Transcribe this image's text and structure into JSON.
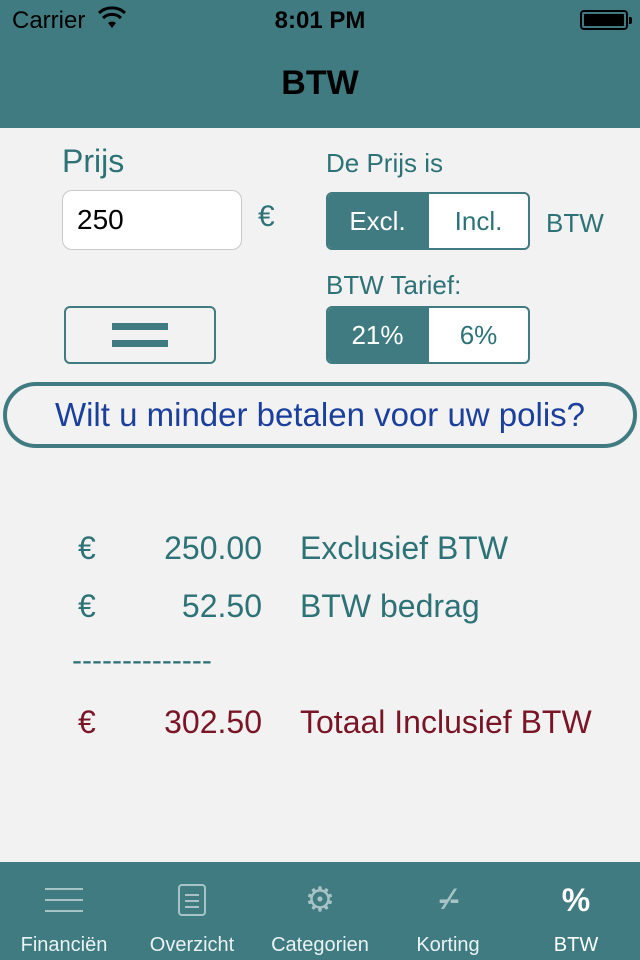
{
  "status_bar": {
    "carrier": "Carrier",
    "time": "8:01 PM"
  },
  "nav": {
    "title": "BTW"
  },
  "form": {
    "price_label": "Prijs",
    "price_value": "250",
    "currency_symbol": "€",
    "price_is_label": "De Prijs is",
    "incl_options": [
      "Excl.",
      "Incl."
    ],
    "incl_selected": "Excl.",
    "btw_suffix": "BTW",
    "rate_label": "BTW Tarief:",
    "rate_options": [
      "21%",
      "6%"
    ],
    "rate_selected": "21%",
    "menu_button_icon": "equals-icon"
  },
  "promo": {
    "text": "Wilt u minder betalen voor uw polis?"
  },
  "results": {
    "excl": {
      "currency": "€",
      "amount": "250.00",
      "label": "Exclusief BTW"
    },
    "btw": {
      "currency": "€",
      "amount": "52.50",
      "label": "BTW bedrag"
    },
    "separator": "--------------",
    "total": {
      "currency": "€",
      "amount": "302.50",
      "label": "Totaal Inclusief BTW"
    }
  },
  "tabbar": {
    "tabs": [
      {
        "label": "Financiën",
        "icon": "lines-icon"
      },
      {
        "label": "Overzicht",
        "icon": "document-icon"
      },
      {
        "label": "Categorien",
        "icon": "gear-icon"
      },
      {
        "label": "Korting",
        "icon": "korting-icon"
      },
      {
        "label": "BTW",
        "icon": "percent-icon"
      }
    ],
    "active": "BTW"
  },
  "colors": {
    "accent": "#3f7b80",
    "text_teal": "#2d7277",
    "total_red": "#7a1526",
    "promo_blue": "#1a3f9c",
    "background": "#f2f2f2"
  }
}
